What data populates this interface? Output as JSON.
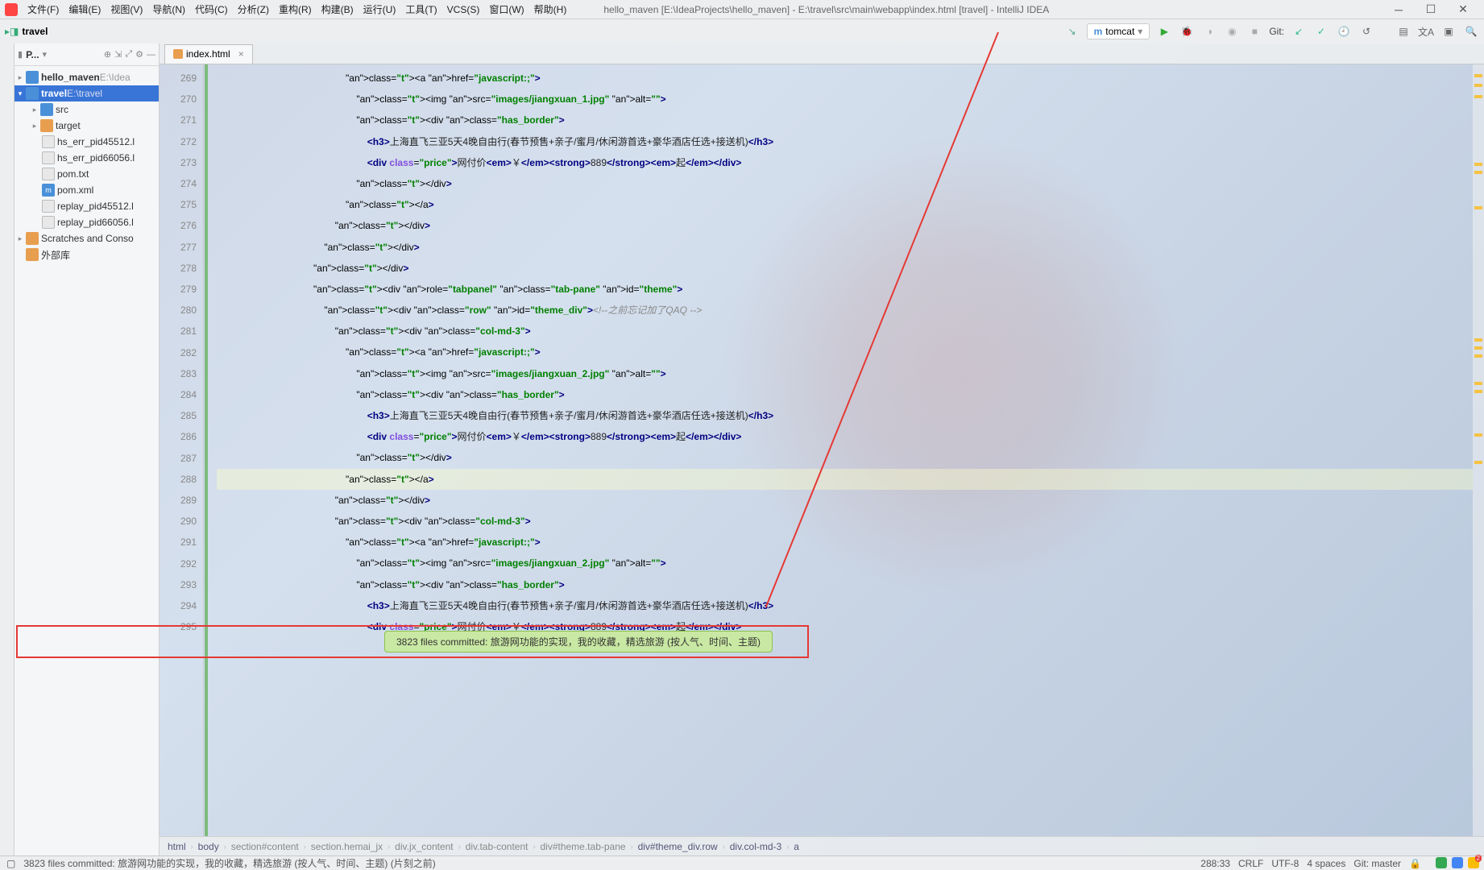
{
  "window": {
    "title": "hello_maven [E:\\IdeaProjects\\hello_maven] - E:\\travel\\src\\main\\webapp\\index.html [travel] - IntelliJ IDEA"
  },
  "menu": {
    "file": "文件(F)",
    "edit": "编辑(E)",
    "view": "视图(V)",
    "nav": "导航(N)",
    "code": "代码(C)",
    "analyze": "分析(Z)",
    "refactor": "重构(R)",
    "build": "构建(B)",
    "run": "运行(U)",
    "tools": "工具(T)",
    "vcs": "VCS(S)",
    "window": "窗口(W)",
    "help": "帮助(H)"
  },
  "toolbar": {
    "project_name": "travel",
    "run_config": "tomcat",
    "git_label": "Git:"
  },
  "project_panel": {
    "title": "P...",
    "root1": "hello_maven",
    "root1_hint": " E:\\Idea",
    "root2": "travel",
    "root2_hint": " E:\\travel",
    "src": "src",
    "target": "target",
    "f1": "hs_err_pid45512.l",
    "f2": "hs_err_pid66056.l",
    "f3": "pom.txt",
    "f4": "pom.xml",
    "f5": "replay_pid45512.l",
    "f6": "replay_pid66056.l",
    "scratches": "Scratches and Conso",
    "external": "外部库"
  },
  "tab": {
    "name": "index.html"
  },
  "gutter": {
    "start": 269,
    "end": 295
  },
  "code_lines": [
    {
      "i": 12,
      "h": "<a href=\"javascript:;\">"
    },
    {
      "i": 13,
      "h": "<img src=\"images/jiangxuan_1.jpg\" alt=\"\">"
    },
    {
      "i": 13,
      "h": "<div class=\"has_border\">"
    },
    {
      "i": 14,
      "t": "<h3>上海直飞三亚5天4晚自由行(春节预售+亲子/蜜月/休闲游首选+豪华酒店任选+接送机)</h3>"
    },
    {
      "i": 14,
      "p": "<div class=\"price\">网付价<em>￥</em><strong>889</strong><em>起</em></div>"
    },
    {
      "i": 13,
      "h": "</div>"
    },
    {
      "i": 12,
      "h": "</a>"
    },
    {
      "i": 11,
      "h": "</div>"
    },
    {
      "i": 10,
      "h": "</div>"
    },
    {
      "i": 9,
      "h": "</div>"
    },
    {
      "i": 9,
      "h2": "<div role=\"tabpanel\" class=\"tab-pane\" id=\"theme\">"
    },
    {
      "i": 10,
      "h3": "<div class=\"row\" id=\"theme_div\">",
      "c": "<!--之前忘记加了QAQ -->"
    },
    {
      "i": 11,
      "h": "<div class=\"col-md-3\">"
    },
    {
      "i": 12,
      "h": "<a href=\"javascript:;\">"
    },
    {
      "i": 13,
      "h": "<img src=\"images/jiangxuan_2.jpg\" alt=\"\">"
    },
    {
      "i": 13,
      "h": "<div class=\"has_border\">"
    },
    {
      "i": 14,
      "t": "<h3>上海直飞三亚5天4晚自由行(春节预售+亲子/蜜月/休闲游首选+豪华酒店任选+接送机)</h3>"
    },
    {
      "i": 14,
      "p": "<div class=\"price\">网付价<em>￥</em><strong>889</strong><em>起</em></div>"
    },
    {
      "i": 13,
      "h": "</div>"
    },
    {
      "i": 12,
      "h": "</a>"
    },
    {
      "i": 11,
      "h": "</div>"
    },
    {
      "i": 11,
      "h": "<div class=\"col-md-3\">"
    },
    {
      "i": 12,
      "h": "<a href=\"javascript:;\">"
    },
    {
      "i": 13,
      "h": "<img src=\"images/jiangxuan_2.jpg\" alt=\"\">"
    },
    {
      "i": 13,
      "h": "<div class=\"has_border\">"
    },
    {
      "i": 14,
      "t": "<h3>上海直飞三亚5天4晚自由行(春节预售+亲子/蜜月/休闲游首选+豪华酒店任选+接送机)</h3>"
    },
    {
      "i": 14,
      "p": "<div class=\"price\">网付价<em>￥</em><strong>889</strong><em>起</em></div>"
    }
  ],
  "breadcrumb": {
    "items": [
      "html",
      "body",
      "section#content",
      "section.hemai_jx",
      "div.jx_content",
      "div.tab-content",
      "div#theme.tab-pane",
      "div#theme_div.row",
      "div.col-md-3",
      "a"
    ]
  },
  "notification": {
    "text": "3823 files committed: 旅游网功能的实现，我的收藏，精选旅游 (按人气、时间、主题)"
  },
  "status": {
    "commit_msg": "3823 files committed: 旅游网功能的实现，我的收藏，精选旅游 (按人气、时间、主题)   (片刻之前)",
    "pos": "288:33",
    "eol": "CRLF",
    "enc": "UTF-8",
    "indent": "4 spaces",
    "git": "Git: master"
  }
}
